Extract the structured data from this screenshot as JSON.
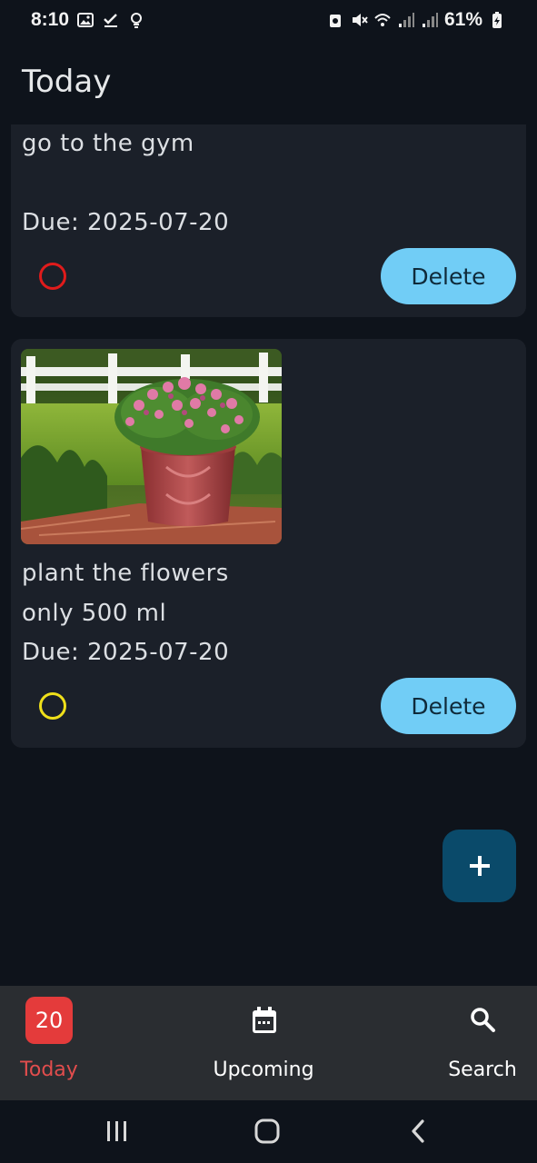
{
  "status_bar": {
    "time": "8:10",
    "battery": "61%"
  },
  "app": {
    "title": "Today"
  },
  "tasks": [
    {
      "lines": [
        "go to the gym"
      ],
      "due": "Due: 2025-07-20",
      "status_color": "#e01b1b",
      "delete_label": "Delete"
    },
    {
      "lines": [
        "plant the flowers",
        "only 500 ml"
      ],
      "due": "Due: 2025-07-20",
      "status_color": "#f0e01a",
      "delete_label": "Delete",
      "image": "flower-pot-photo"
    }
  ],
  "fab": {
    "icon": "plus-icon"
  },
  "bottom_nav": {
    "today": {
      "badge": "20",
      "label": "Today",
      "color": "#e24d4d"
    },
    "upcoming": {
      "label": "Upcoming",
      "icon": "calendar-icon"
    },
    "search": {
      "label": "Search",
      "icon": "search-icon"
    }
  },
  "colors": {
    "background": "#0e131b",
    "card": "#1b2029",
    "accent": "#71cdf6"
  }
}
